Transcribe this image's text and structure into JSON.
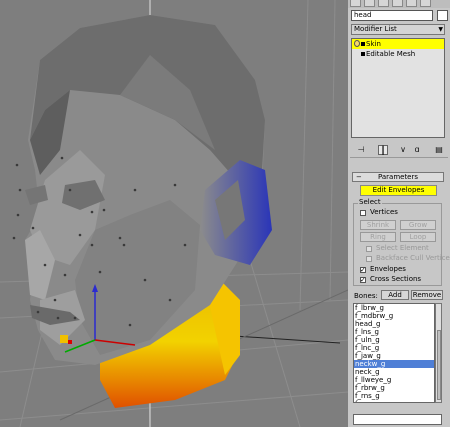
{
  "object_name": "head",
  "modifier_list_label": "Modifier List",
  "modifier_stack": [
    {
      "label": "Skin",
      "selected": true
    },
    {
      "label": "Editable Mesh",
      "selected": false
    }
  ],
  "rollout": {
    "title": "Parameters",
    "collapse_symbol": "−",
    "edit_envelopes_label": "Edit Envelopes"
  },
  "select_group": {
    "title": "Select",
    "vertices_label": "Vertices",
    "shrink_label": "Shrink",
    "grow_label": "Grow",
    "ring_label": "Ring",
    "loop_label": "Loop",
    "select_element_label": "Select Element",
    "backface_cull_label": "Backface Cull Vertices",
    "envelopes_label": "Envelopes",
    "cross_sections_label": "Cross Sections"
  },
  "bones": {
    "label": "Bones:",
    "add_label": "Add",
    "remove_label": "Remove",
    "items": [
      "f_lbrw_g",
      "f_mdbrw_g",
      "head_g",
      "f_lns_g",
      "f_uln_g",
      "f_lnc_g",
      "f_jaw_g",
      "neckw_g",
      "neck_g",
      "f_llweye_g",
      "f_rbrw_g",
      "f_rns_g",
      "f_rnc_g",
      "f_rlweye_g"
    ],
    "selected_index": 7
  },
  "colors": {
    "selection_yellow": "#ffff00",
    "list_highlight": "#4f7fd6",
    "panel_bg": "#c7c7c7",
    "viewport_bg": "#7e7e7e"
  }
}
